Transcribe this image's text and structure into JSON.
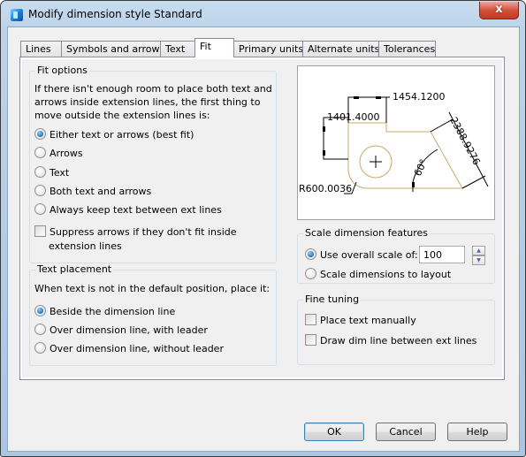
{
  "window": {
    "title": "Modify dimension style Standard",
    "close_label": "x"
  },
  "tabs": [
    {
      "label": "Lines",
      "active": false
    },
    {
      "label": "Symbols and arrows",
      "active": false
    },
    {
      "label": "Text",
      "active": false
    },
    {
      "label": "Fit",
      "active": true
    },
    {
      "label": "Primary units",
      "active": false
    },
    {
      "label": "Alternate units",
      "active": false
    },
    {
      "label": "Tolerances",
      "active": false
    }
  ],
  "fit_options": {
    "title": "Fit options",
    "description": "If there isn't enough room to place both text and arrows inside extension lines, the first thing to move outside the extension lines is:",
    "options": [
      {
        "label": "Either text or arrows (best fit)",
        "checked": true
      },
      {
        "label": "Arrows",
        "checked": false
      },
      {
        "label": "Text",
        "checked": false
      },
      {
        "label": "Both text and arrows",
        "checked": false
      },
      {
        "label": "Always keep text between ext lines",
        "checked": false
      }
    ],
    "suppress_label_line1": "Suppress arrows if they don't fit inside",
    "suppress_label_line2": "extension lines",
    "suppress_checked": false
  },
  "text_placement": {
    "title": "Text placement",
    "description": "When text is not in the default position, place it:",
    "options": [
      {
        "label": "Beside the dimension line",
        "checked": true
      },
      {
        "label": "Over dimension line, with leader",
        "checked": false
      },
      {
        "label": "Over dimension line, without leader",
        "checked": false
      }
    ]
  },
  "preview": {
    "dim_top": "1454.1200",
    "dim_left": "1401.4000",
    "dim_aligned": "2388.9276",
    "dim_angle": "60°",
    "dim_radius": "R600.0036",
    "colors": {
      "geometry": "#c8a968",
      "dimension": "#000000"
    }
  },
  "scale_features": {
    "title": "Scale dimension features",
    "use_overall_label": "Use overall scale of:",
    "use_overall_checked": true,
    "scale_value": "100",
    "scale_to_layout_label": "Scale dimensions to layout",
    "scale_to_layout_checked": false,
    "spin_up": "▲",
    "spin_down": "▼"
  },
  "fine_tuning": {
    "title": "Fine tuning",
    "place_manually_label": "Place text manually",
    "place_manually_checked": false,
    "draw_dim_line_label": "Draw dim line between ext lines",
    "draw_dim_line_checked": false
  },
  "buttons": {
    "ok": "OK",
    "cancel": "Cancel",
    "help": "Help"
  }
}
